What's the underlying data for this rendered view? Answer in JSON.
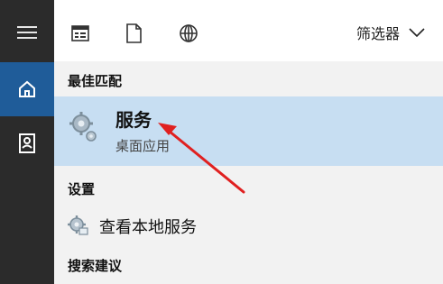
{
  "sidebar": {
    "items": [
      {
        "icon": "hamburger-menu-icon"
      },
      {
        "icon": "home-icon"
      },
      {
        "icon": "user-icon"
      }
    ],
    "accent": "#1f5c99"
  },
  "topbar": {
    "icons": [
      "app-list-icon",
      "document-icon",
      "globe-icon"
    ],
    "filter_label": "筛选器"
  },
  "best_match": {
    "header": "最佳匹配",
    "title": "服务",
    "subtitle": "桌面应用",
    "icon": "gear-services-icon",
    "highlight": "#c7def2"
  },
  "settings": {
    "header": "设置",
    "item_label": "查看本地服务",
    "item_icon": "gear-settings-icon"
  },
  "suggestions": {
    "header": "搜索建议"
  },
  "annotation": {
    "arrow_color": "#e02020"
  }
}
